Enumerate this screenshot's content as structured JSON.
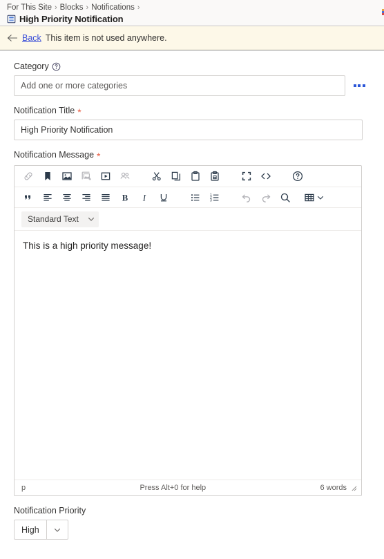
{
  "header": {
    "breadcrumb": [
      {
        "label": "For This Site"
      },
      {
        "label": "Blocks"
      },
      {
        "label": "Notifications"
      }
    ],
    "separator": "›",
    "page_title": "High Priority Notification",
    "doc_icon": "document-icon"
  },
  "notice": {
    "back_icon": "arrow-left-icon",
    "back_label": "Back",
    "message": "This item is not used anywhere.",
    "background": "#fdf8e8",
    "link_color": "#3b4fd8"
  },
  "form": {
    "category": {
      "label": "Category",
      "help_icon": "help-circle-icon",
      "placeholder": "Add one or more categories",
      "value": "",
      "more_button": "ellipsis-icon",
      "more_color": "#2b56d8"
    },
    "notification_title": {
      "label": "Notification Title",
      "required": "*",
      "required_color": "#e85c41",
      "value": "High Priority Notification"
    },
    "notification_message": {
      "label": "Notification Message",
      "required": "*",
      "body_text": "This is a high priority message!",
      "format_select": {
        "value": "Standard Text",
        "chevron": "chevron-down-icon"
      },
      "toolbar_row1": [
        {
          "name": "insert-link-icon",
          "label": "Insert link",
          "disabled": true
        },
        {
          "name": "bookmark-icon",
          "label": "Bookmark",
          "disabled": false
        },
        {
          "name": "insert-image-icon",
          "label": "Insert image",
          "disabled": false
        },
        {
          "name": "image-placeholder-icon",
          "label": "Image placeholder",
          "disabled": true
        },
        {
          "name": "insert-video-icon",
          "label": "Insert video",
          "disabled": false
        },
        {
          "name": "people-icon",
          "label": "People",
          "disabled": true
        },
        {
          "name": "cut-icon",
          "label": "Cut",
          "disabled": false
        },
        {
          "name": "copy-icon",
          "label": "Copy",
          "disabled": false
        },
        {
          "name": "paste-icon",
          "label": "Paste",
          "disabled": false
        },
        {
          "name": "paste-as-text-icon",
          "label": "Paste as text",
          "disabled": false
        },
        {
          "name": "fullscreen-icon",
          "label": "Fullscreen",
          "disabled": false
        },
        {
          "name": "source-code-icon",
          "label": "Source code",
          "disabled": false
        },
        {
          "name": "help-icon",
          "label": "Help",
          "disabled": false
        }
      ],
      "toolbar_row2": [
        {
          "name": "blockquote-icon",
          "label": "Blockquote",
          "disabled": false
        },
        {
          "name": "align-left-icon",
          "label": "Align left",
          "disabled": false
        },
        {
          "name": "align-center-icon",
          "label": "Align center",
          "disabled": false
        },
        {
          "name": "align-right-icon",
          "label": "Align right",
          "disabled": false
        },
        {
          "name": "align-justify-icon",
          "label": "Justify",
          "disabled": false
        },
        {
          "name": "bold-icon",
          "label": "Bold",
          "disabled": false
        },
        {
          "name": "italic-icon",
          "label": "Italic",
          "disabled": false
        },
        {
          "name": "underline-icon",
          "label": "Underline",
          "disabled": false
        },
        {
          "name": "bullet-list-icon",
          "label": "Bullet list",
          "disabled": false
        },
        {
          "name": "numbered-list-icon",
          "label": "Numbered list",
          "disabled": false
        },
        {
          "name": "undo-icon",
          "label": "Undo",
          "disabled": true
        },
        {
          "name": "redo-icon",
          "label": "Redo",
          "disabled": true
        },
        {
          "name": "search-icon",
          "label": "Find and replace",
          "disabled": false
        },
        {
          "name": "table-icon",
          "label": "Table",
          "disabled": false
        }
      ],
      "status_bar": {
        "element_path": "p",
        "help_hint": "Press Alt+0 for help",
        "word_count": "6 words",
        "resize_handle": "resize-grip-icon"
      }
    },
    "notification_priority": {
      "label": "Notification Priority",
      "value": "High",
      "chevron": "chevron-down-icon"
    }
  }
}
